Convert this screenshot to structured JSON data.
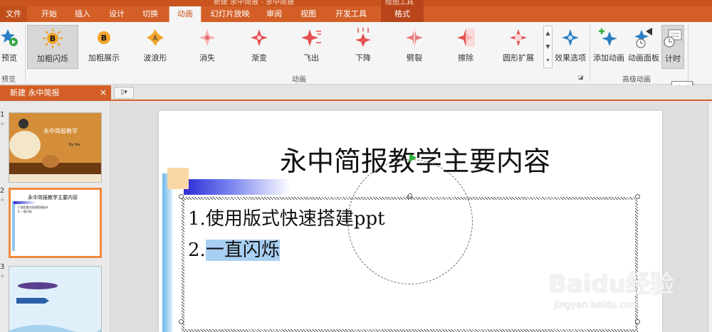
{
  "titlebar": {
    "text": "新建 永中简报 - 永中简报",
    "context_group": "绘图工具"
  },
  "tabs": [
    {
      "label": "文件"
    },
    {
      "label": "开始"
    },
    {
      "label": "插入"
    },
    {
      "label": "设计"
    },
    {
      "label": "切换"
    },
    {
      "label": "动画"
    },
    {
      "label": "幻灯片放映"
    },
    {
      "label": "审阅"
    },
    {
      "label": "视图"
    },
    {
      "label": "开发工具"
    },
    {
      "label": "格式"
    }
  ],
  "ribbon": {
    "preview": {
      "label": "预览",
      "group": "预览"
    },
    "effects": [
      {
        "label": "加粗闪烁"
      },
      {
        "label": "加粗展示"
      },
      {
        "label": "波浪形"
      },
      {
        "label": "消失"
      },
      {
        "label": "渐变"
      },
      {
        "label": "飞出"
      },
      {
        "label": "下降"
      },
      {
        "label": "劈裂"
      },
      {
        "label": "擦除"
      },
      {
        "label": "圆形扩展"
      }
    ],
    "effect_options": {
      "label": "效果选项"
    },
    "animation_group": "动画",
    "add_animation": {
      "label": "添加动画"
    },
    "animation_pane": {
      "label": "动画面板"
    },
    "timing": {
      "label": "计时"
    },
    "advanced_group": "高级动画",
    "tooltip": "计时"
  },
  "doc_tab": {
    "title": "新建 永中简报",
    "close": "×"
  },
  "thumbnails": [
    {
      "num": "1",
      "title": "永中简报教学",
      "subtitle": "By Me"
    },
    {
      "num": "2",
      "title": "永中简报教学主要内容",
      "line1": "1.使用版式快速搭建ppt",
      "line2": "2.一直闪烁"
    },
    {
      "num": "3"
    }
  ],
  "slide": {
    "title": "永中简报教学主要内容",
    "bullets": [
      {
        "num": "1.",
        "text": "使用版式快速搭建ppt"
      },
      {
        "num": "2.",
        "text": "一直闪烁"
      }
    ]
  },
  "watermark": {
    "brand": "Baidu经验",
    "url": "jingyan.baidu.com"
  },
  "colors": {
    "accent": "#d35f27",
    "selected_thumb": "#f08a3c",
    "highlight": "#a9cff2"
  }
}
